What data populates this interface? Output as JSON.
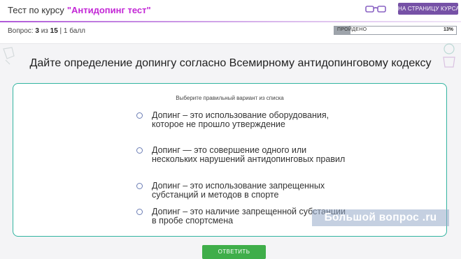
{
  "header": {
    "title_prefix": "Тест по курсу",
    "course_name": "\"Антидопинг тест\"",
    "course_page_button": "НА СТРАНИЦУ КУРСА"
  },
  "meta": {
    "question_label": "Вопрос:",
    "current": "3",
    "of_label": "из",
    "total": "15",
    "points": "| 1 балл"
  },
  "progress": {
    "label": "ПРОЙДЕНО",
    "value_text": "13%",
    "value": 0.13
  },
  "question": {
    "title": "Дайте определение допингу согласно Всемирному антидопинговому кодексу",
    "hint": "Выберите правильный вариант из списка",
    "options": [
      {
        "label": "Допинг – это использование оборудования, которое не прошло утверждение"
      },
      {
        "label": "Допинг — это совершение одного или нескольких нарушений антидопинговых правил"
      },
      {
        "label": "Допинг – это использование запрещенных субстанций и методов в спорте"
      },
      {
        "label": "Допинг – это наличие запрещенной субстанции в пробе спортсмена"
      }
    ]
  },
  "watermark": "Большой вопрос .ru",
  "submit_label": "ОТВЕТИТЬ",
  "colors": {
    "accent_purple": "#7651a6",
    "course_name": "#c327d6",
    "card_border": "#32b4a0",
    "submit": "#3fae4a"
  }
}
